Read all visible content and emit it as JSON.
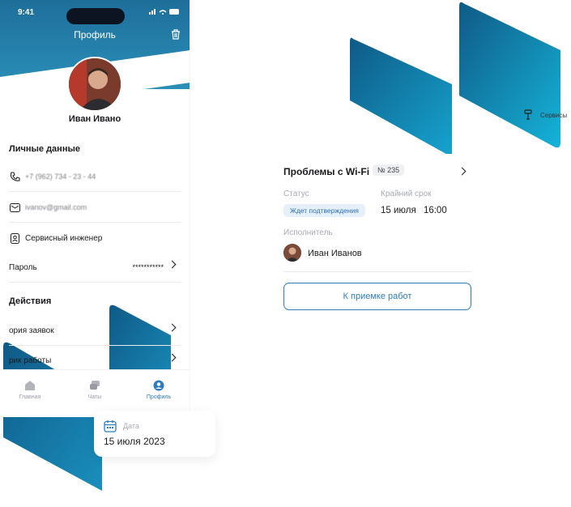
{
  "colors": {
    "accent": "#2f7dbd",
    "header": "#1e6f9a",
    "deco_dark": "#0f5a86",
    "deco_light": "#15b3d9"
  },
  "statusbar": {
    "time": "9:41"
  },
  "phone": {
    "title": "Профиль",
    "user_name": "Иван Ивано",
    "personal_section": "Личные данные",
    "phone_value": "+7 (962) 734 - 23 - 44",
    "email_value": "ivanov@gmail.com",
    "role": "Сервисный инженер",
    "password_label": "Пароль",
    "password_value": "***********",
    "actions_section": "Действия",
    "action_history": "ория заявок",
    "action_schedule": "рик работы",
    "tabs": [
      {
        "label": "Главная",
        "icon": "home-icon",
        "active": false
      },
      {
        "label": "Чаты",
        "icon": "chat-icon",
        "active": false
      },
      {
        "label": "Профиль",
        "icon": "profile-icon",
        "active": true
      }
    ]
  },
  "card": {
    "title": "Проблемы с Wi-Fi",
    "number": "№ 235",
    "status_label": "Статус",
    "status_value": "Ждет подтверждения",
    "deadline_label": "Крайний срок",
    "deadline_date": "15 июля",
    "deadline_time": "16:00",
    "executor_label": "Исполнитель",
    "executor_name": "Иван Иванов",
    "accept_button": "К приемке работ"
  },
  "date_card": {
    "label": "Дата",
    "value": "15 июля 2023"
  },
  "services": {
    "label": "Сервисы",
    "icon": "services-icon"
  }
}
